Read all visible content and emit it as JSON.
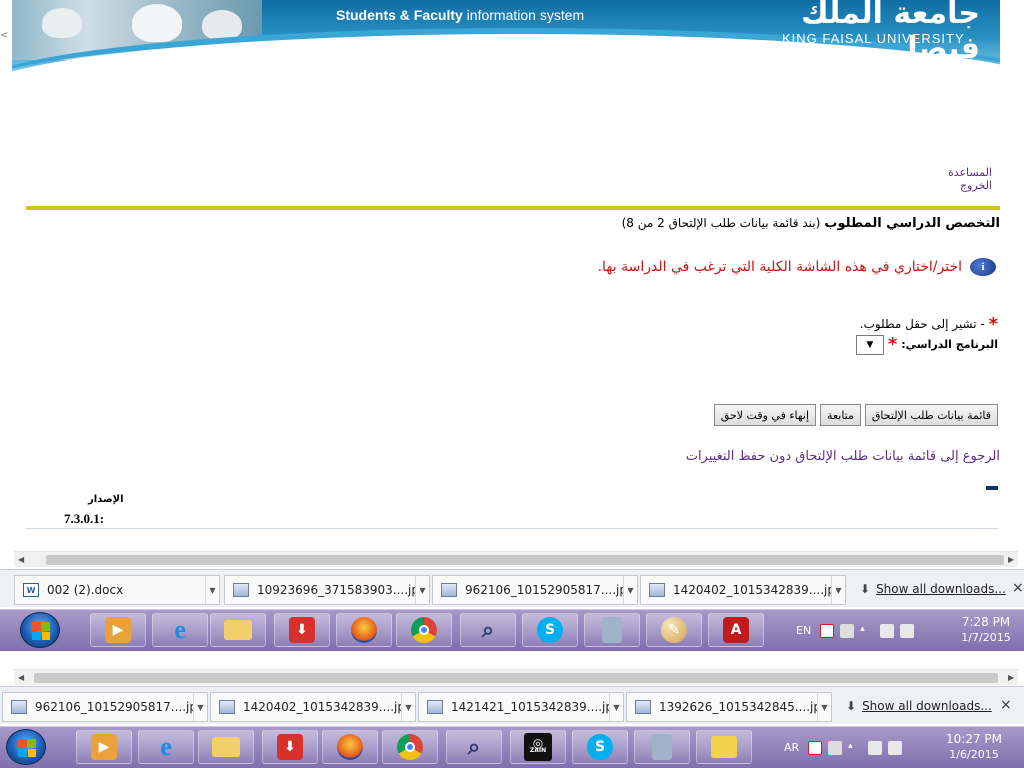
{
  "banner": {
    "system_bold": "Students & Faculty",
    "system_rest": " information system",
    "university_ar": "جامعة الملك فيصل",
    "university_en": "KING FAISAL UNIVERSITY"
  },
  "top_links": {
    "help": "المساعدة",
    "logout": "الخروج"
  },
  "page": {
    "title": "التخصص الدراسي المطلوب",
    "subtitle": "(بند قائمة بيانات طلب الإلتحاق 2 من 8)",
    "instruction": "اختر/اختاري في هذه الشاشة الكلية التي ترغب في الدراسة بها.",
    "required_note": "- تشير إلى حقل مطلوب.",
    "program_label": "البرنامج الدراسي:",
    "program_value": "▼",
    "buttons": {
      "list": "قائمة بيانات طلب الإلتحاق",
      "continue": "متابعة",
      "finish_later": "إنهاء في وقت لاحق"
    },
    "back_link": "الرجوع إلى قائمة بيانات طلب الإلتحاق دون حفظ التغييرات",
    "version_label": "الإصدار",
    "version_value": "7.3.0.1:"
  },
  "downloads_top": {
    "items": [
      "002 (2).docx",
      "10923696_371583903....jpg",
      "962106_10152905817....jpg",
      "1420402_1015342839....jpg"
    ],
    "show_all": "Show all downloads...",
    "close": "×"
  },
  "taskbar_top": {
    "lang": "EN",
    "time": "7:28 PM",
    "date": "1/7/2015"
  },
  "downloads_bottom": {
    "items": [
      "962106_10152905817....jpg",
      "1420402_1015342839....jpg",
      "1421421_1015342839....jpg",
      "1392626_1015342845....jpg"
    ],
    "show_all": "Show all downloads...",
    "close": "×"
  },
  "taskbar_bottom": {
    "lang": "AR",
    "time": "10:27 PM",
    "date": "1/6/2015",
    "zain": "ZAIN"
  },
  "colors": {
    "link_purple": "#5b2d86",
    "alert_red": "#d11212",
    "gold": "#c9c31c",
    "taskbar": "#8f80bb"
  }
}
